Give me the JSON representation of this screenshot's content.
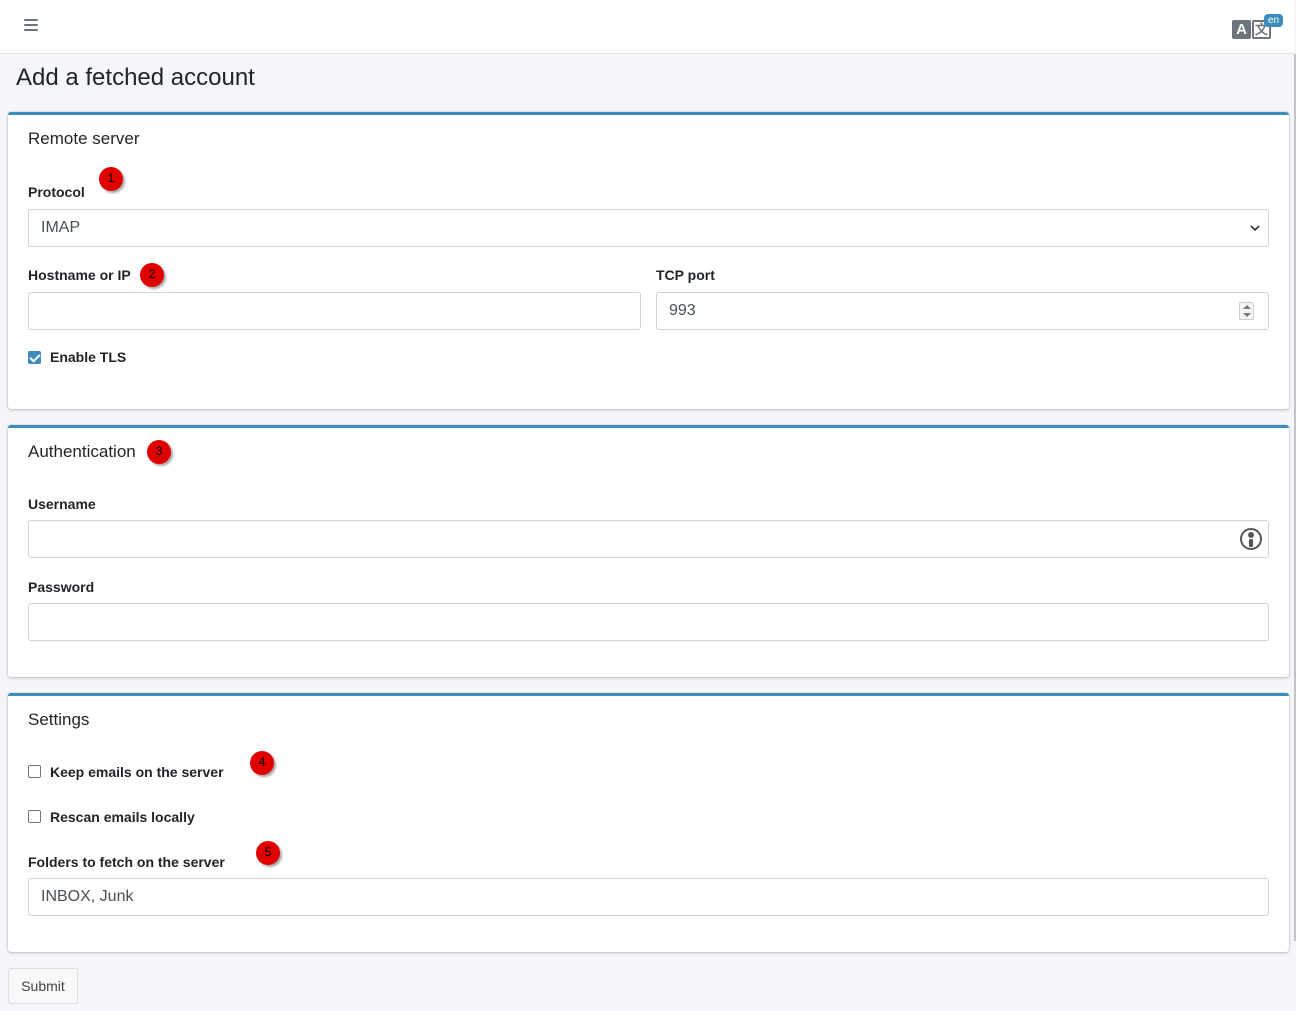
{
  "header": {
    "menu_icon": "hamburger-icon",
    "language_icon": "translate-icon",
    "language_glyph_a": "A",
    "language_glyph_b": "文",
    "language_badge": "en"
  },
  "page": {
    "title": "Add a fetched account"
  },
  "remote_server": {
    "title": "Remote server",
    "protocol_label": "Protocol",
    "protocol_value": "IMAP",
    "hostname_label": "Hostname or IP",
    "hostname_value": "",
    "port_label": "TCP port",
    "port_value": "993",
    "tls_label": "Enable TLS",
    "tls_checked": true
  },
  "authentication": {
    "title": "Authentication",
    "username_label": "Username",
    "username_value": "",
    "password_label": "Password",
    "password_value": ""
  },
  "settings": {
    "title": "Settings",
    "keep_label": "Keep emails on the server",
    "keep_checked": false,
    "rescan_label": "Rescan emails locally",
    "rescan_checked": false,
    "folders_label": "Folders to fetch on the server",
    "folders_value": "INBOX, Junk"
  },
  "markers": [
    "1",
    "2",
    "3",
    "4",
    "5"
  ],
  "colors": {
    "accent": "#3c8dbc",
    "marker": "#e00000"
  },
  "submit_label": "Submit"
}
